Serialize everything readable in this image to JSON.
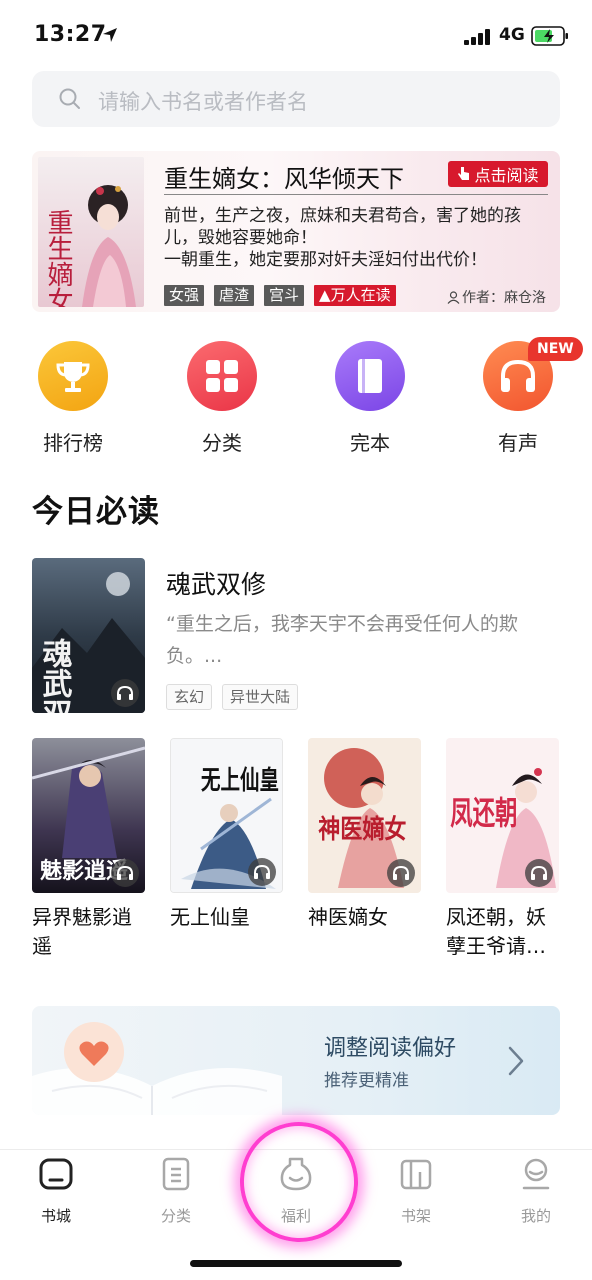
{
  "status_bar": {
    "time": "13:27",
    "network": "4G"
  },
  "search": {
    "placeholder": "请输入书名或者作者名"
  },
  "banner": {
    "cover_text": "重生嫡女",
    "title": "重生嫡女：风华倾天下",
    "read_button": "点击阅读",
    "description": "前世，生产之夜，庶妹和夫君苟合，害了她的孩儿，毁她容要她命！\n一朝重生，她定要那对奸夫淫妇付出代价！",
    "tags": [
      "女强",
      "虐渣",
      "宫斗"
    ],
    "hot_tag": "万人在读",
    "author": "作者：麻仓洛"
  },
  "categories": [
    {
      "label": "排行榜",
      "icon": "trophy-icon",
      "color": "#f7b324"
    },
    {
      "label": "分类",
      "icon": "grid-icon",
      "color": "#f04a57"
    },
    {
      "label": "完本",
      "icon": "book-icon",
      "color": "#8e5cf0"
    },
    {
      "label": "有声",
      "icon": "headphones-icon",
      "color": "#f66a3b",
      "badge": "NEW"
    }
  ],
  "section": {
    "title": "今日必读"
  },
  "featured": {
    "title": "魂武双修",
    "description": "“重生之后，我李天宇不会再受任何人的欺负。...",
    "tags": [
      "玄幻",
      "异世大陆"
    ],
    "cover_text": "魂武双修"
  },
  "books": [
    {
      "title": "异界魅影逍遥",
      "cover_text": "魅影逍遥"
    },
    {
      "title": "无上仙皇",
      "cover_text": "无上仙皇"
    },
    {
      "title": "神医嫡女",
      "cover_text": "神医嫡女"
    },
    {
      "title": "凤还朝，妖孽王爷请…",
      "cover_text": "凤还朝"
    }
  ],
  "preference": {
    "title": "调整阅读偏好",
    "subtitle": "推荐更精准"
  },
  "tabs": [
    {
      "label": "书城",
      "icon": "home-icon",
      "active": true
    },
    {
      "label": "分类",
      "icon": "list-icon",
      "active": false
    },
    {
      "label": "福利",
      "icon": "gift-pot-icon",
      "active": false
    },
    {
      "label": "书架",
      "icon": "shelf-icon",
      "active": false
    },
    {
      "label": "我的",
      "icon": "user-icon",
      "active": false
    }
  ]
}
